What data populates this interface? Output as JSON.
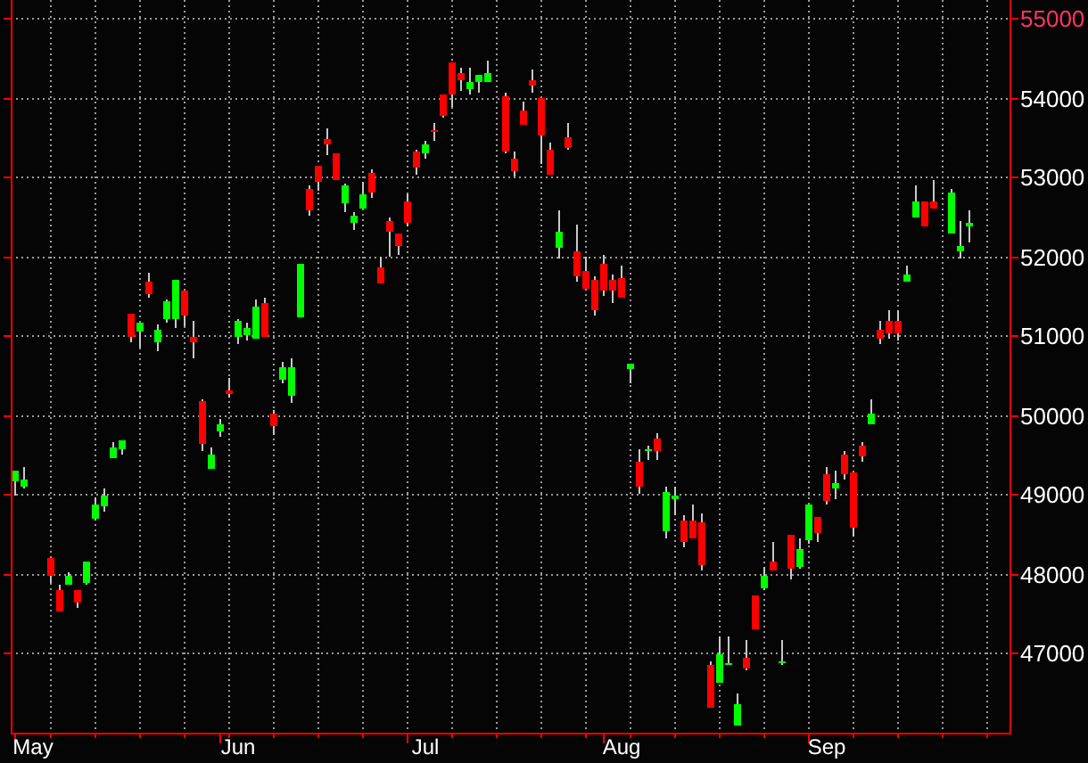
{
  "chart": {
    "chart_data": {
      "type": "candlestick",
      "ylim": [
        45990,
        55230
      ],
      "categories": [
        null,
        null,
        "May",
        null,
        null,
        null,
        null,
        null,
        null,
        null,
        null,
        null,
        null,
        null,
        null,
        null,
        null,
        null,
        null,
        null,
        null,
        null,
        null,
        null,
        null,
        "Jun",
        null,
        null,
        null,
        null,
        null,
        null,
        null,
        null,
        null,
        null,
        null,
        null,
        null,
        null,
        null,
        null,
        null,
        null,
        null,
        null,
        "Jul",
        null,
        null,
        null,
        null,
        null,
        null,
        null,
        null,
        null,
        null,
        null,
        null,
        null,
        null,
        null,
        null,
        null,
        null,
        null,
        null,
        null,
        "Aug",
        null,
        null,
        null,
        null,
        null,
        null,
        null,
        null,
        null,
        null,
        null,
        null,
        null,
        null,
        null,
        null,
        null,
        null,
        null,
        null,
        null,
        null,
        "Sep",
        null,
        null,
        null,
        null,
        null,
        null,
        null,
        null,
        null,
        null,
        null,
        null,
        null,
        null,
        null,
        null,
        null,
        null,
        null,
        null
      ],
      "grid": true,
      "yticks": [
        47000,
        48000,
        49000,
        50000,
        51000,
        52000,
        53000,
        54000,
        55000
      ],
      "ohlc": [
        [
          49290,
          49290,
          48980,
          49160
        ],
        [
          49180,
          49340,
          49070,
          49090
        ],
        null,
        null,
        [
          47960,
          48190,
          47870,
          48190
        ],
        [
          47510,
          47850,
          47510,
          47780
        ],
        [
          47960,
          48010,
          47850,
          47850
        ],
        [
          47620,
          47780,
          47560,
          47780
        ],
        [
          48140,
          48140,
          47850,
          47870
        ],
        [
          48860,
          48950,
          48660,
          48680
        ],
        [
          48980,
          49070,
          48770,
          48840
        ],
        [
          49580,
          49650,
          49450,
          49450
        ],
        [
          49670,
          49670,
          49490,
          49560
        ],
        [
          50980,
          51270,
          50910,
          51270
        ],
        [
          51160,
          51160,
          50850,
          51050
        ],
        [
          51520,
          51790,
          51480,
          51680
        ],
        [
          51070,
          51140,
          50800,
          50910
        ],
        [
          51430,
          51450,
          51160,
          51210
        ],
        [
          51700,
          51700,
          51090,
          51210
        ],
        [
          51250,
          51570,
          51120,
          51570
        ],
        [
          50910,
          51180,
          50710,
          50980
        ],
        [
          49630,
          50190,
          49540,
          50170
        ],
        [
          49490,
          49580,
          49310,
          49310
        ],
        [
          49880,
          49940,
          49720,
          49790
        ],
        [
          50260,
          50460,
          50210,
          50300
        ],
        [
          51180,
          51210,
          50890,
          50980
        ],
        [
          51090,
          51160,
          50940,
          51000
        ],
        [
          51360,
          51450,
          50960,
          50960
        ],
        [
          50980,
          51480,
          50980,
          51410
        ],
        [
          49850,
          50060,
          49740,
          50010
        ],
        [
          50600,
          50660,
          50390,
          50440
        ],
        [
          50600,
          50710,
          50150,
          50240
        ],
        [
          51900,
          51900,
          51230,
          51230
        ],
        [
          52580,
          52890,
          52510,
          52850
        ],
        [
          52940,
          53140,
          52830,
          53140
        ],
        [
          53410,
          53620,
          53280,
          53480
        ],
        [
          52960,
          53300,
          52960,
          53300
        ],
        [
          52890,
          52920,
          52560,
          52670
        ],
        [
          52510,
          52560,
          52330,
          52420
        ],
        [
          52780,
          52940,
          52600,
          52600
        ],
        [
          52800,
          53100,
          52740,
          53050
        ],
        [
          51660,
          51990,
          51660,
          51860
        ],
        [
          52310,
          52490,
          51990,
          52440
        ],
        [
          52130,
          52290,
          52020,
          52290
        ],
        [
          52420,
          52780,
          52380,
          52690
        ],
        [
          53120,
          53340,
          53030,
          53320
        ],
        [
          53410,
          53460,
          53230,
          53300
        ],
        [
          53570,
          53680,
          53460,
          53590
        ],
        [
          53770,
          54040,
          53750,
          54040
        ],
        [
          54040,
          54450,
          53890,
          54450
        ],
        [
          54220,
          54380,
          54090,
          54310
        ],
        [
          54200,
          54380,
          54040,
          54110
        ],
        [
          54290,
          54290,
          54070,
          54200
        ],
        [
          54310,
          54470,
          54200,
          54200
        ],
        null,
        [
          53320,
          54070,
          53300,
          54020
        ],
        [
          53070,
          53320,
          53010,
          53230
        ],
        [
          53660,
          53950,
          53660,
          53840
        ],
        [
          54160,
          54360,
          54070,
          54220
        ],
        [
          53520,
          54000,
          53160,
          54000
        ],
        [
          53030,
          53430,
          53030,
          53340
        ],
        [
          52310,
          52580,
          51970,
          52110
        ],
        [
          53370,
          53680,
          53340,
          53500
        ],
        [
          51750,
          52400,
          51680,
          52060
        ],
        [
          51590,
          51990,
          51590,
          51810
        ],
        [
          51320,
          51750,
          51250,
          51700
        ],
        [
          51570,
          52020,
          51500,
          51900
        ],
        [
          51570,
          51770,
          51410,
          51700
        ],
        [
          51480,
          51880,
          51480,
          51720
        ],
        [
          50640,
          50640,
          50390,
          50570
        ],
        [
          49090,
          49560,
          49000,
          49400
        ],
        [
          49560,
          49610,
          49430,
          49540
        ],
        [
          49540,
          49760,
          49430,
          49700
        ],
        [
          49020,
          49090,
          48440,
          48530
        ],
        [
          48980,
          49090,
          48730,
          48930
        ],
        [
          48390,
          48730,
          48320,
          48660
        ],
        [
          48440,
          48860,
          48440,
          48660
        ],
        [
          48100,
          48750,
          48030,
          48640
        ],
        [
          46300,
          46900,
          46300,
          46840
        ],
        [
          46970,
          47200,
          46610,
          46610
        ],
        [
          46860,
          47200,
          46840,
          46840
        ],
        [
          46340,
          46480,
          46090,
          46090
        ],
        [
          46790,
          47150,
          46770,
          46930
        ],
        [
          47290,
          47710,
          47290,
          47710
        ],
        [
          47960,
          48080,
          47780,
          47800
        ],
        [
          48030,
          48390,
          48030,
          48140
        ],
        [
          46900,
          47170,
          46840,
          46880
        ],
        [
          48050,
          48480,
          47920,
          48480
        ],
        [
          48300,
          48440,
          48050,
          48080
        ],
        [
          48860,
          48860,
          48370,
          48410
        ],
        [
          48500,
          48710,
          48390,
          48710
        ],
        [
          48910,
          49340,
          48860,
          49250
        ],
        [
          49130,
          49290,
          48930,
          49070
        ],
        [
          49250,
          49540,
          49180,
          49490
        ],
        [
          48570,
          49270,
          48460,
          49270
        ],
        [
          49470,
          49650,
          49400,
          49610
        ],
        [
          50010,
          50190,
          49880,
          49880
        ],
        [
          50960,
          51180,
          50890,
          51070
        ],
        [
          51030,
          51320,
          50960,
          51180
        ],
        [
          51030,
          51320,
          50940,
          51180
        ],
        [
          51770,
          51880,
          51680,
          51680
        ],
        [
          52690,
          52890,
          52490,
          52490
        ],
        [
          52380,
          52690,
          52380,
          52690
        ],
        [
          52600,
          52960,
          52600,
          52690
        ],
        null,
        [
          52800,
          52850,
          52290,
          52290
        ],
        [
          52130,
          52440,
          51970,
          52060
        ],
        [
          52420,
          52580,
          52170,
          52380
        ],
        null,
        null,
        null,
        null
      ]
    }
  }
}
